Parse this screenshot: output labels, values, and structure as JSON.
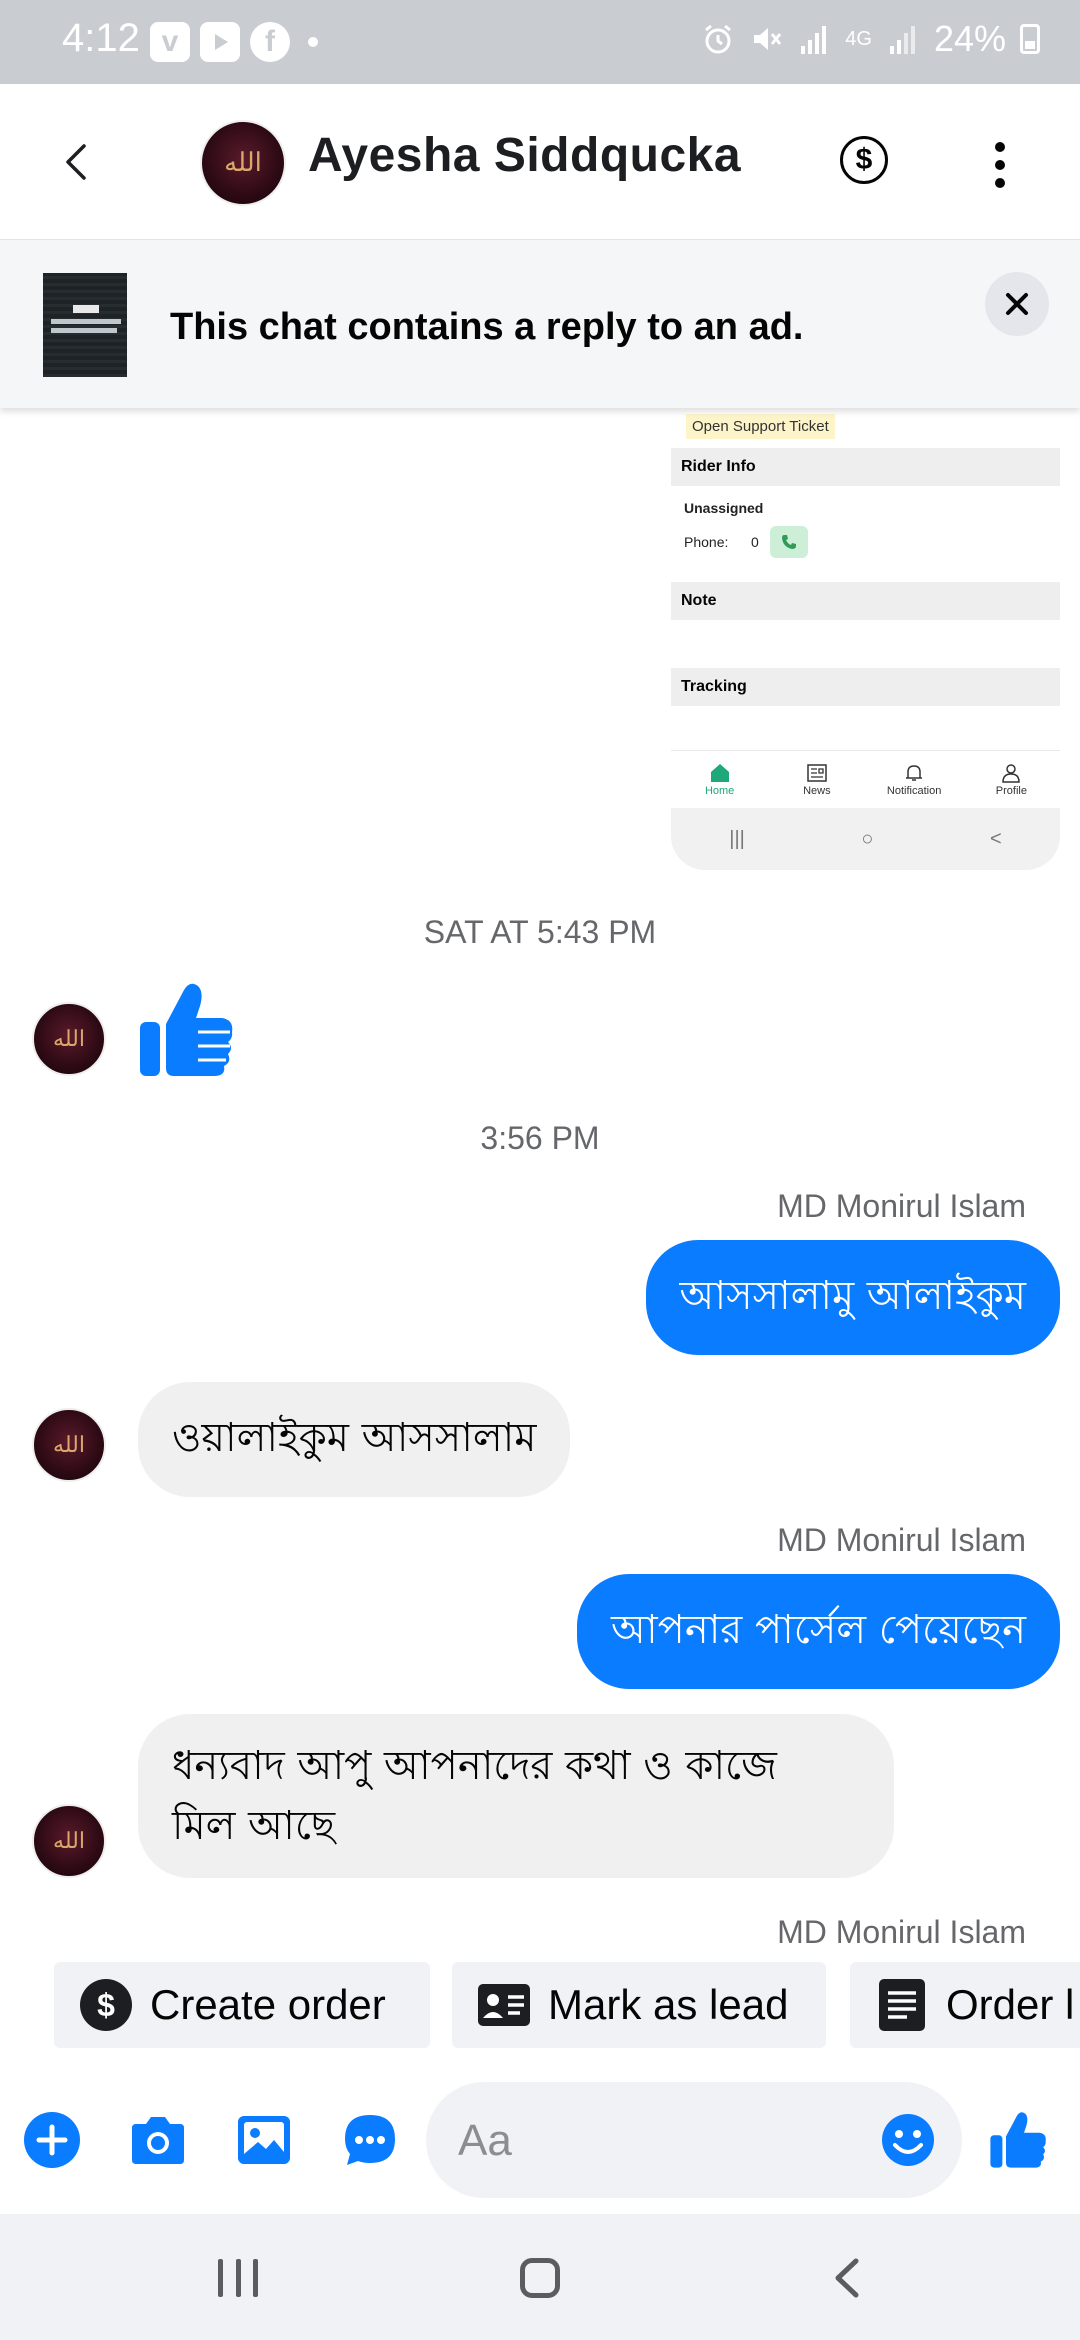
{
  "status_bar": {
    "time": "4:12",
    "battery": "24%",
    "network": "4G",
    "left_icons": [
      "v-app-icon",
      "youtube-icon",
      "facebook-icon",
      "dot-icon"
    ],
    "right_icons": [
      "alarm-icon",
      "mute-icon",
      "signal-icon",
      "signal-icon",
      "battery-icon"
    ]
  },
  "header": {
    "title": "Ayesha Siddqucka",
    "icons": [
      "back-icon",
      "avatar",
      "dollar-icon",
      "more-icon"
    ]
  },
  "ad_banner": {
    "text": "This chat contains a reply to an ad."
  },
  "shared_screenshot": {
    "ticket_label": "Open Support Ticket",
    "rider_info_title": "Rider Info",
    "rider_status": "Unassigned",
    "phone_label": "Phone:",
    "phone_value": "0",
    "note_title": "Note",
    "tracking_title": "Tracking",
    "nav": [
      {
        "label": "Home",
        "icon": "home-icon"
      },
      {
        "label": "News",
        "icon": "news-icon"
      },
      {
        "label": "Notification",
        "icon": "bell-icon"
      },
      {
        "label": "Profile",
        "icon": "profile-icon"
      }
    ],
    "sys_nav": [
      "|||",
      "○",
      "<"
    ]
  },
  "messages": {
    "timestamp_1": "SAT AT 5:43 PM",
    "timestamp_2": "3:56 PM",
    "sender_name": "MD Monirul Islam",
    "out_1": "আসসালামু আলাইকুম",
    "in_1": "ওয়ালাইকুম আসসালাম",
    "out_2": "আপনার পার্সেল পেয়েছেন",
    "in_2_line1": "ধন্যবাদ আপু আপনাদের কথা ও কাজে",
    "in_2_line2": "মিল আছে",
    "avatar_text": "الله"
  },
  "chips": {
    "create_order": "Create order",
    "mark_as_lead": "Mark as lead",
    "order": "Order l"
  },
  "composer": {
    "placeholder": "Aa",
    "icons": [
      "plus-icon",
      "camera-icon",
      "image-icon",
      "chat-bubble-icon",
      "emoji-icon",
      "like-icon"
    ]
  },
  "colors": {
    "messenger_blue": "#0a7cff",
    "incoming_bubble": "#f0f0f0",
    "status_bar": "#c9ccd1"
  }
}
